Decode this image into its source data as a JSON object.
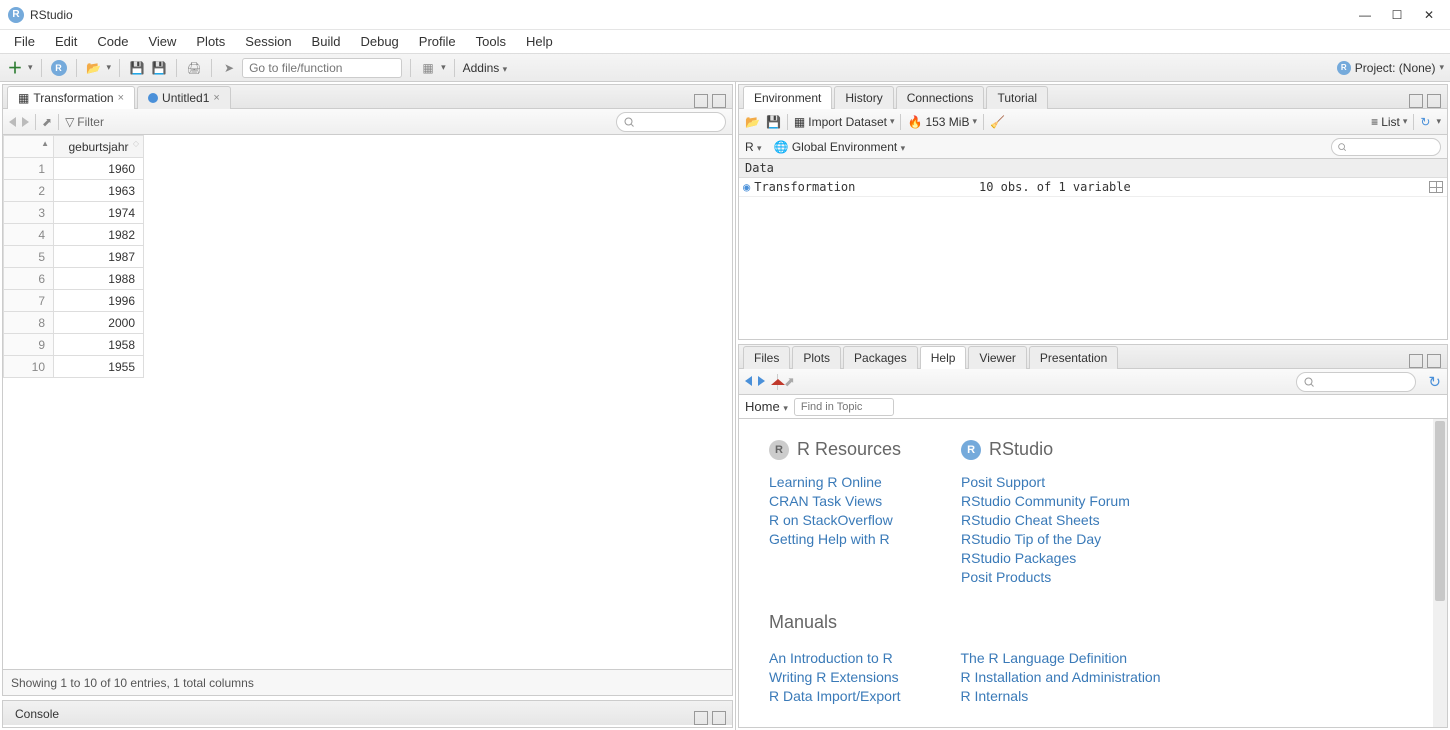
{
  "app": {
    "title": "RStudio"
  },
  "menus": [
    "File",
    "Edit",
    "Code",
    "View",
    "Plots",
    "Session",
    "Build",
    "Debug",
    "Profile",
    "Tools",
    "Help"
  ],
  "main_toolbar": {
    "goto_placeholder": "Go to file/function",
    "addins": "Addins",
    "project": "Project: (None)"
  },
  "source": {
    "tabs": [
      {
        "label": "Transformation",
        "active": true,
        "icon": "grid"
      },
      {
        "label": "Untitled1",
        "active": false,
        "icon": "r"
      }
    ],
    "filter_label": "Filter",
    "columns": [
      "geburtsjahr"
    ],
    "rows": [
      {
        "n": "1",
        "v": "1960"
      },
      {
        "n": "2",
        "v": "1963"
      },
      {
        "n": "3",
        "v": "1974"
      },
      {
        "n": "4",
        "v": "1982"
      },
      {
        "n": "5",
        "v": "1987"
      },
      {
        "n": "6",
        "v": "1988"
      },
      {
        "n": "7",
        "v": "1996"
      },
      {
        "n": "8",
        "v": "2000"
      },
      {
        "n": "9",
        "v": "1958"
      },
      {
        "n": "10",
        "v": "1955"
      }
    ],
    "status": "Showing 1 to 10 of 10 entries, 1 total columns"
  },
  "console": {
    "label": "Console"
  },
  "env": {
    "tabs": [
      "Environment",
      "History",
      "Connections",
      "Tutorial"
    ],
    "active_tab": 0,
    "import_label": "Import Dataset",
    "mem": "153 MiB",
    "list_label": "List",
    "lang": "R",
    "scope": "Global Environment",
    "section": "Data",
    "items": [
      {
        "name": "Transformation",
        "desc": "10 obs. of 1 variable"
      }
    ]
  },
  "help": {
    "tabs": [
      "Files",
      "Plots",
      "Packages",
      "Help",
      "Viewer",
      "Presentation"
    ],
    "active_tab": 3,
    "home_label": "Home",
    "find_placeholder": "Find in Topic",
    "sections": {
      "resources_title": "R Resources",
      "rstudio_title": "RStudio",
      "manuals_title": "Manuals",
      "resources": [
        "Learning R Online",
        "CRAN Task Views",
        "R on StackOverflow",
        "Getting Help with R"
      ],
      "rstudio": [
        "Posit Support",
        "RStudio Community Forum",
        "RStudio Cheat Sheets",
        "RStudio Tip of the Day",
        "RStudio Packages",
        "Posit Products"
      ],
      "manuals_left": [
        "An Introduction to R",
        "Writing R Extensions",
        "R Data Import/Export"
      ],
      "manuals_right": [
        "The R Language Definition",
        "R Installation and Administration",
        "R Internals"
      ]
    }
  }
}
